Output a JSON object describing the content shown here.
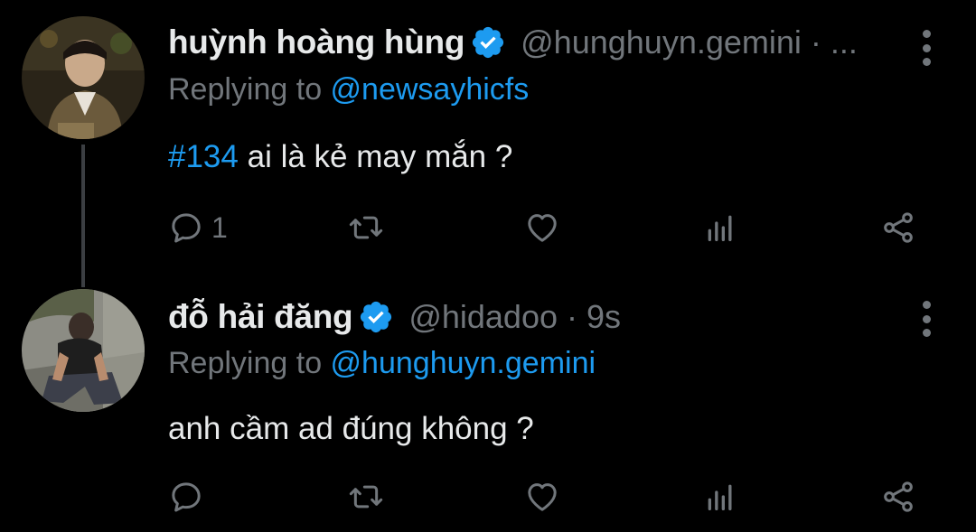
{
  "tweets": [
    {
      "name": "huỳnh hoàng hùng",
      "handle": "@hunghuyn.gemini · ...",
      "replying_prefix": "Replying to ",
      "replying_to": "@newsayhicfs",
      "hashtag": "#134",
      "text": " ai là kẻ may mắn ?",
      "reply_count": "1",
      "avatar_icon": "user-avatar-photo"
    },
    {
      "name": "đỗ hải đăng",
      "handle": "@hidadoo · 9s",
      "replying_prefix": "Replying to ",
      "replying_to": "@hunghuyn.gemini",
      "text": "anh cầm ad đúng không ?",
      "avatar_icon": "user-avatar-photo"
    }
  ],
  "colors": {
    "background": "#000000",
    "text": "#e7e9ea",
    "muted": "#71767b",
    "accent": "#1d9bf0"
  }
}
